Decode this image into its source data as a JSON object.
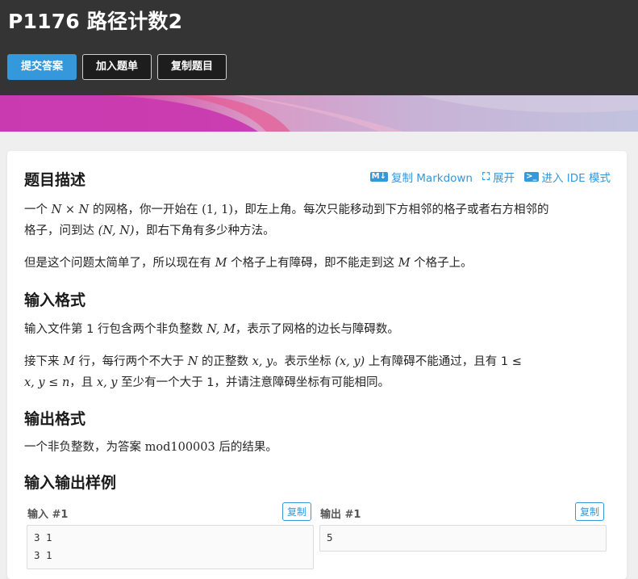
{
  "header": {
    "title": "P1176 路径计数2",
    "buttons": {
      "submit": "提交答案",
      "add": "加入题单",
      "copy": "复制题目"
    }
  },
  "tools": {
    "copy_md": "复制 Markdown",
    "expand": "展开",
    "ide": "进入 IDE 模式"
  },
  "sections": {
    "description_title": "题目描述",
    "input_title": "输入格式",
    "output_title": "输出格式",
    "samples_title": "输入输出样例"
  },
  "description": {
    "l1_a": "一个 ",
    "l1_m1": "N",
    "l1_x": " × ",
    "l1_m2": "N",
    "l1_b": " 的网格，你一开始在 ",
    "l1_m3": "(1, 1)",
    "l1_c": "，即左上角。每次只能移动到下方相邻的格子或者右方相邻的",
    "l2_a": "格子，问到达 ",
    "l2_m": "(N, N)",
    "l2_b": "，即右下角有多少种方法。",
    "l3_a": "但是这个问题太简单了，所以现在有 ",
    "l3_m1": "M",
    "l3_b": " 个格子上有障碍，即不能走到这 ",
    "l3_m2": "M",
    "l3_c": " 个格子上。"
  },
  "input": {
    "l1_a": "输入文件第 1 行包含两个非负整数 ",
    "l1_m": "N, M",
    "l1_b": "，表示了网格的边长与障碍数。",
    "l2_a": "接下来 ",
    "l2_m1": "M",
    "l2_b": " 行，每行两个不大于 ",
    "l2_m2": "N",
    "l2_c": " 的正整数 ",
    "l2_m3": "x, y",
    "l2_d": "。表示坐标 ",
    "l2_m4": "(x, y)",
    "l2_e": " 上有障碍不能通过，且有 1 ≤",
    "l3_m1": "x, y ≤ n",
    "l3_a": "，且 ",
    "l3_m2": "x, y",
    "l3_b": " 至少有一个大于 1，并请注意障碍坐标有可能相同。"
  },
  "output": {
    "l1_a": "一个非负整数，为答案 ",
    "l1_m": "mod100003",
    "l1_b": " 后的结果。"
  },
  "samples": {
    "input_label": "输入 #1",
    "output_label": "输出 #1",
    "copy_label": "复制",
    "input_text": "3 1\n3 1",
    "output_text": "5"
  }
}
